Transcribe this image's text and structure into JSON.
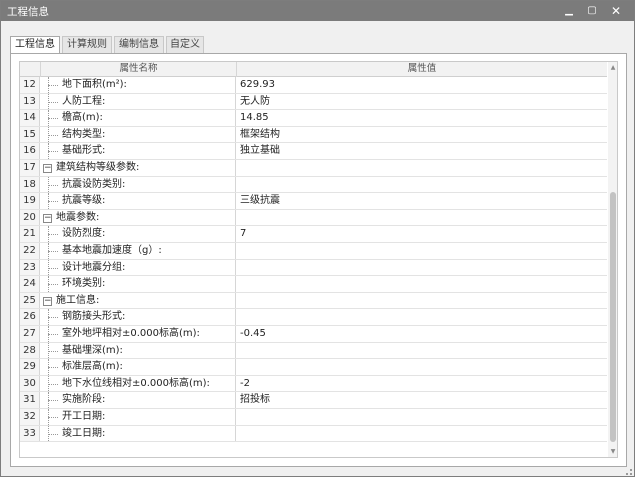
{
  "window": {
    "title": "工程信息",
    "min_icon": "minimize-icon",
    "max_icon": "maximize-icon",
    "close_icon": "close-icon"
  },
  "tabs": [
    {
      "label": "工程信息",
      "active": true
    },
    {
      "label": "计算规则",
      "active": false
    },
    {
      "label": "编制信息",
      "active": false
    },
    {
      "label": "自定义",
      "active": false
    }
  ],
  "grid": {
    "col_name": "属性名称",
    "col_value": "属性值",
    "rows": [
      {
        "num": "12",
        "name": "地下面积(m²):",
        "value": "629.93",
        "kind": "child"
      },
      {
        "num": "13",
        "name": "人防工程:",
        "value": "无人防",
        "kind": "child"
      },
      {
        "num": "14",
        "name": "檐高(m):",
        "value": "14.85",
        "kind": "child"
      },
      {
        "num": "15",
        "name": "结构类型:",
        "value": "框架结构",
        "kind": "child"
      },
      {
        "num": "16",
        "name": "基础形式:",
        "value": "独立基础",
        "kind": "child"
      },
      {
        "num": "17",
        "name": "建筑结构等级参数:",
        "value": "",
        "kind": "group"
      },
      {
        "num": "18",
        "name": "抗震设防类别:",
        "value": "",
        "kind": "child"
      },
      {
        "num": "19",
        "name": "抗震等级:",
        "value": "三级抗震",
        "kind": "child"
      },
      {
        "num": "20",
        "name": "地震参数:",
        "value": "",
        "kind": "group"
      },
      {
        "num": "21",
        "name": "设防烈度:",
        "value": "7",
        "kind": "child"
      },
      {
        "num": "22",
        "name": "基本地震加速度（g）:",
        "value": "",
        "kind": "child"
      },
      {
        "num": "23",
        "name": "设计地震分组:",
        "value": "",
        "kind": "child"
      },
      {
        "num": "24",
        "name": "环境类别:",
        "value": "",
        "kind": "child"
      },
      {
        "num": "25",
        "name": "施工信息:",
        "value": "",
        "kind": "group"
      },
      {
        "num": "26",
        "name": "钢筋接头形式:",
        "value": "",
        "kind": "child"
      },
      {
        "num": "27",
        "name": "室外地坪相对±0.000标高(m):",
        "value": "-0.45",
        "kind": "child"
      },
      {
        "num": "28",
        "name": "基础埋深(m):",
        "value": "",
        "kind": "child"
      },
      {
        "num": "29",
        "name": "标准层高(m):",
        "value": "",
        "kind": "child"
      },
      {
        "num": "30",
        "name": "地下水位线相对±0.000标高(m):",
        "value": "-2",
        "kind": "child"
      },
      {
        "num": "31",
        "name": "实施阶段:",
        "value": "招投标",
        "kind": "child"
      },
      {
        "num": "32",
        "name": "开工日期:",
        "value": "",
        "kind": "child"
      },
      {
        "num": "33",
        "name": "竣工日期:",
        "value": "",
        "kind": "child"
      }
    ]
  }
}
